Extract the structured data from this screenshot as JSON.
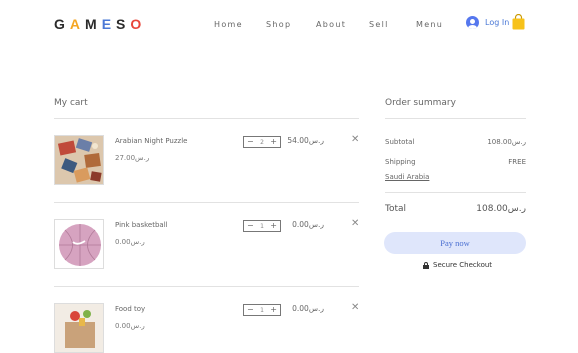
{
  "brand": {
    "letters": [
      {
        "char": "G",
        "color": "#2b2b2b"
      },
      {
        "char": "A",
        "color": "#f5a623"
      },
      {
        "char": "M",
        "color": "#2b2b2b"
      },
      {
        "char": "E",
        "color": "#4a78d6"
      },
      {
        "char": "S",
        "color": "#2b2b2b"
      },
      {
        "char": "O",
        "color": "#e8463a"
      }
    ]
  },
  "nav": {
    "home": "Home",
    "shop": "Shop",
    "about": "About",
    "sell": "Sell",
    "menu": "Menu"
  },
  "header": {
    "login_label": "Log In",
    "cart_icon": "shopping-bag-icon",
    "cart_color": "#f7c21a",
    "login_color": "#4a78d6"
  },
  "cart": {
    "title": "My cart",
    "items": [
      {
        "name": "Arabian Night Puzzle",
        "price": "27.00ر.س",
        "qty": "2",
        "line_total": "54.00ر.س"
      },
      {
        "name": "Pink basketball",
        "price": "0.00ر.س",
        "qty": "1",
        "line_total": "0.00ر.س"
      },
      {
        "name": "Food toy",
        "price": "0.00ر.س",
        "qty": "1",
        "line_total": "0.00ر.س"
      }
    ]
  },
  "summary": {
    "title": "Order summary",
    "subtotal_label": "Subtotal",
    "subtotal_value": "108.00ر.س",
    "shipping_label": "Shipping",
    "shipping_value": "FREE",
    "country": "Saudi Arabia",
    "total_label": "Total",
    "total_value": "108.00ر.س",
    "pay_label": "Pay now",
    "secure_label": "Secure Checkout",
    "pay_bg": "#dfe6fb",
    "pay_text": "#4a6fd1"
  }
}
